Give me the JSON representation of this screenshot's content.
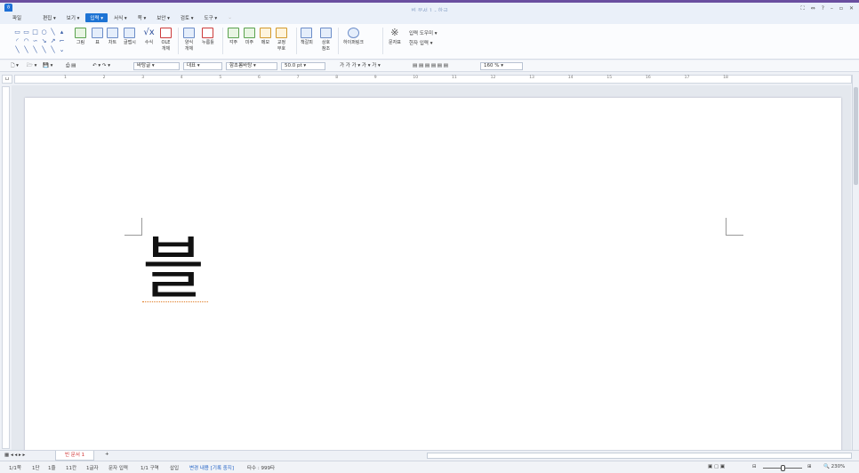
{
  "window": {
    "title": "빈 문서 1 - 한글",
    "controls": [
      "⛶",
      "⇔",
      "?",
      "–",
      "▫",
      "✕"
    ]
  },
  "menus": [
    {
      "label": "파일",
      "cls": "file"
    },
    {
      "label": "편집 ▾",
      "cls": ""
    },
    {
      "label": "보기 ▾",
      "cls": ""
    },
    {
      "label": "입력 ▾",
      "cls": "active"
    },
    {
      "label": "서식 ▾",
      "cls": ""
    },
    {
      "label": "쪽 ▾",
      "cls": ""
    },
    {
      "label": "보안 ▾",
      "cls": ""
    },
    {
      "label": "검토 ▾",
      "cls": ""
    },
    {
      "label": "도구 ▾",
      "cls": ""
    },
    {
      "label": "⌄",
      "cls": "dis"
    }
  ],
  "ribbon": {
    "picture": "그림",
    "table": "표",
    "chart": "차트",
    "glyph": "글맵시",
    "formula": "수식",
    "ole": "OLE\n개체",
    "form_object": "양식\n개체",
    "push_button": "누름틀",
    "footnote": "각주",
    "endnote": "미주",
    "memo": "메모",
    "correction": "교정\n부호",
    "bookmark": "책갈피",
    "crossref": "상호\n참조",
    "hyperlink": "하이퍼링크",
    "charmap": "문자표",
    "input_tools": "입력 도우미 ▾",
    "hanja_input": "한자 입력 ▾"
  },
  "toolbar": {
    "style": "바탕글",
    "lang": "대표",
    "font": "함초롬바탕",
    "size": "50.0",
    "unit": "pt",
    "zoom": "160",
    "zoom_unit": "%"
  },
  "ruler_numbers": [
    "1",
    "2",
    "3",
    "4",
    "5",
    "6",
    "7",
    "8",
    "9",
    "10",
    "11",
    "12",
    "13",
    "14",
    "15",
    "16",
    "17",
    "18"
  ],
  "document": {
    "text": "블"
  },
  "tabs": {
    "doc": "빈 문서 1",
    "add": "+"
  },
  "status": {
    "page": "1/1쪽",
    "section": "1단",
    "line": "1줄",
    "col": "11칸",
    "chars": "1글자",
    "mode": "문자 입력",
    "area": "1/1 구역",
    "insert": "삽입",
    "track": "변경 내용 [기록 중지]",
    "typing": "타수 : 999타",
    "zoom": "230%"
  }
}
